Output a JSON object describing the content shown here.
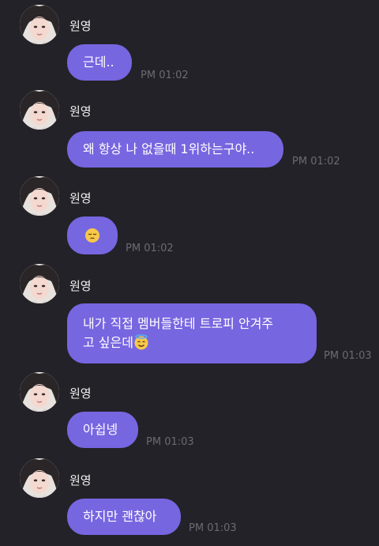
{
  "sender": "원영",
  "messages": [
    {
      "text": "근데..",
      "time": "PM 01:02"
    },
    {
      "text": "왜 항상 나 없을때 1위하는구야..",
      "time": "PM 01:02"
    },
    {
      "text": "",
      "emoji": "pensive-face-icon",
      "time": "PM 01:02"
    },
    {
      "text_line1": "내가 직접 멤버들한테 트로피 안겨주",
      "text_line2": "고 싶은데",
      "emoji": "smiling-face-with-halo-icon",
      "time": "PM 01:03"
    },
    {
      "text": "아쉽넹",
      "time": "PM 01:03"
    },
    {
      "text": "하지만 괜찮아",
      "time": "PM 01:03"
    }
  ],
  "colors": {
    "background": "#232228",
    "bubble": "#7666e0",
    "time": "#6c6a72"
  }
}
